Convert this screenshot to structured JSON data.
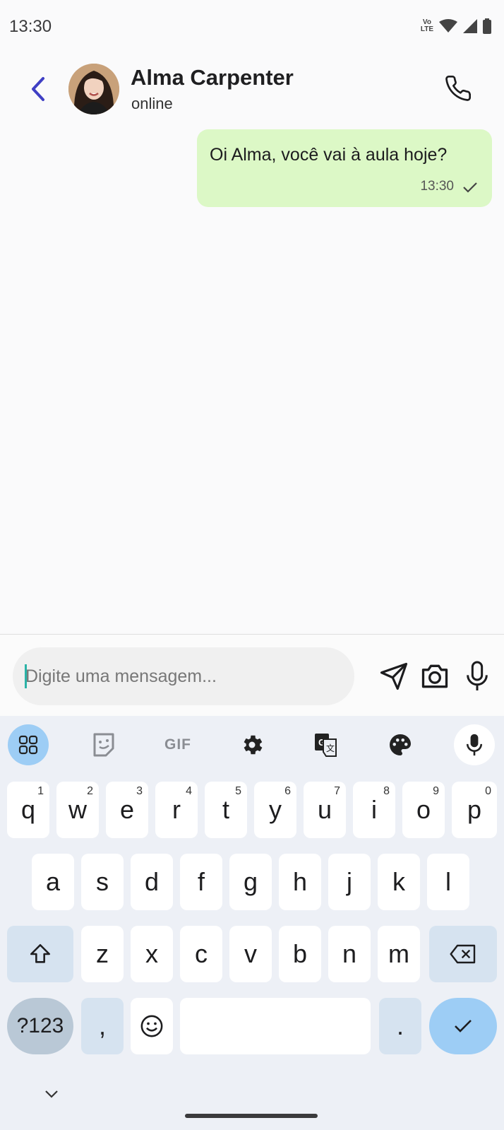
{
  "status_bar": {
    "time": "13:30",
    "volte_top": "Vo",
    "volte_bottom": "LTE"
  },
  "header": {
    "contact_name": "Alma Carpenter",
    "contact_status": "online",
    "accent_color": "#3f3fc4"
  },
  "messages": [
    {
      "text": "Oi Alma, você vai à aula hoje?",
      "time": "13:30",
      "status": "sent",
      "bubble_color": "#dcf8c6"
    }
  ],
  "composer": {
    "placeholder": "Digite uma mensagem..."
  },
  "keyboard": {
    "toolbar": {
      "gif_label": "GIF"
    },
    "row1": [
      {
        "label": "q",
        "hint": "1"
      },
      {
        "label": "w",
        "hint": "2"
      },
      {
        "label": "e",
        "hint": "3"
      },
      {
        "label": "r",
        "hint": "4"
      },
      {
        "label": "t",
        "hint": "5"
      },
      {
        "label": "y",
        "hint": "6"
      },
      {
        "label": "u",
        "hint": "7"
      },
      {
        "label": "i",
        "hint": "8"
      },
      {
        "label": "o",
        "hint": "9"
      },
      {
        "label": "p",
        "hint": "0"
      }
    ],
    "row2": [
      "a",
      "s",
      "d",
      "f",
      "g",
      "h",
      "j",
      "k",
      "l"
    ],
    "row3": [
      "z",
      "x",
      "c",
      "v",
      "b",
      "n",
      "m"
    ],
    "row4": {
      "symbols_label": "?123",
      "comma_label": ",",
      "period_label": "."
    }
  }
}
